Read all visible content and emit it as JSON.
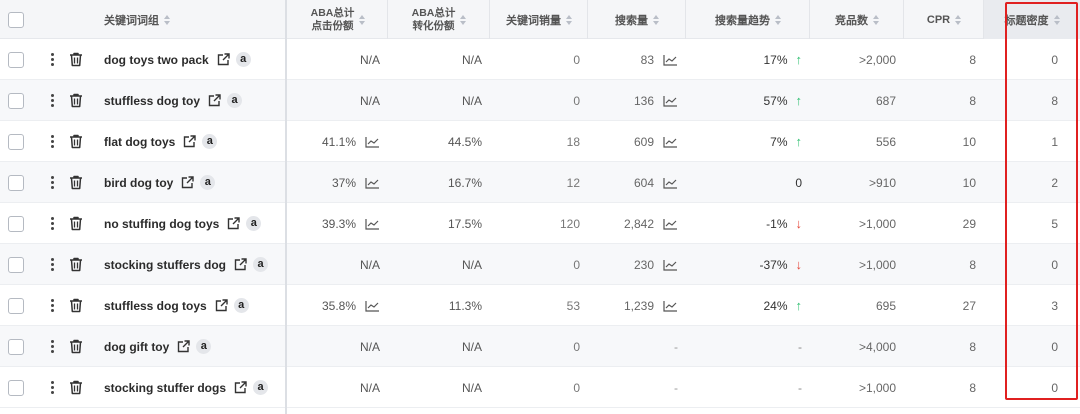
{
  "header": {
    "keyword_group": "关键词词组",
    "aba_click_share": [
      "ABA总计",
      "点击份额"
    ],
    "aba_conv_share": [
      "ABA总计",
      "转化份额"
    ],
    "keyword_sales": "关键词销量",
    "search_volume": "搜索量",
    "search_trend": "搜索量趋势",
    "competitors": "竞品数",
    "cpr": "CPR",
    "title_density": "标题密度"
  },
  "colors": {
    "trend_up": "#2fbf71",
    "trend_down": "#e5483b",
    "highlight_box": "#e02020"
  },
  "rows": [
    {
      "keyword": "dog toys two pack",
      "click_share": "N/A",
      "click_chart": false,
      "conv_share": "N/A",
      "sales": "0",
      "volume": "83",
      "volume_chart": true,
      "trend": "17%",
      "trend_dir": "up",
      "competitors": ">2,000",
      "cpr": "8",
      "density": "0"
    },
    {
      "keyword": "stuffless dog toy",
      "click_share": "N/A",
      "click_chart": false,
      "conv_share": "N/A",
      "sales": "0",
      "volume": "136",
      "volume_chart": true,
      "trend": "57%",
      "trend_dir": "up",
      "competitors": "687",
      "cpr": "8",
      "density": "8"
    },
    {
      "keyword": "flat dog toys",
      "click_share": "41.1%",
      "click_chart": true,
      "conv_share": "44.5%",
      "sales": "18",
      "volume": "609",
      "volume_chart": true,
      "trend": "7%",
      "trend_dir": "up",
      "competitors": "556",
      "cpr": "10",
      "density": "1"
    },
    {
      "keyword": "bird dog toy",
      "click_share": "37%",
      "click_chart": true,
      "conv_share": "16.7%",
      "sales": "12",
      "volume": "604",
      "volume_chart": true,
      "trend": "0",
      "trend_dir": "none",
      "competitors": ">910",
      "cpr": "10",
      "density": "2"
    },
    {
      "keyword": "no stuffing dog toys",
      "click_share": "39.3%",
      "click_chart": true,
      "conv_share": "17.5%",
      "sales": "120",
      "volume": "2,842",
      "volume_chart": true,
      "trend": "-1%",
      "trend_dir": "down",
      "competitors": ">1,000",
      "cpr": "29",
      "density": "5"
    },
    {
      "keyword": "stocking stuffers dog",
      "click_share": "N/A",
      "click_chart": false,
      "conv_share": "N/A",
      "sales": "0",
      "volume": "230",
      "volume_chart": true,
      "trend": "-37%",
      "trend_dir": "down",
      "competitors": ">1,000",
      "cpr": "8",
      "density": "0"
    },
    {
      "keyword": "stuffless dog toys",
      "click_share": "35.8%",
      "click_chart": true,
      "conv_share": "11.3%",
      "sales": "53",
      "volume": "1,239",
      "volume_chart": true,
      "trend": "24%",
      "trend_dir": "up",
      "competitors": "695",
      "cpr": "27",
      "density": "3"
    },
    {
      "keyword": "dog gift toy",
      "click_share": "N/A",
      "click_chart": false,
      "conv_share": "N/A",
      "sales": "0",
      "volume": "-",
      "volume_chart": false,
      "trend": "-",
      "trend_dir": "none",
      "competitors": ">4,000",
      "cpr": "8",
      "density": "0"
    },
    {
      "keyword": "stocking stuffer dogs",
      "click_share": "N/A",
      "click_chart": false,
      "conv_share": "N/A",
      "sales": "0",
      "volume": "-",
      "volume_chart": false,
      "trend": "-",
      "trend_dir": "none",
      "competitors": ">1,000",
      "cpr": "8",
      "density": "0"
    }
  ],
  "icons": {
    "amazon_badge": "a",
    "external_link": "external-link-icon",
    "trash": "trash-icon",
    "more": "more-vertical-icon",
    "chart": "line-chart-icon"
  }
}
